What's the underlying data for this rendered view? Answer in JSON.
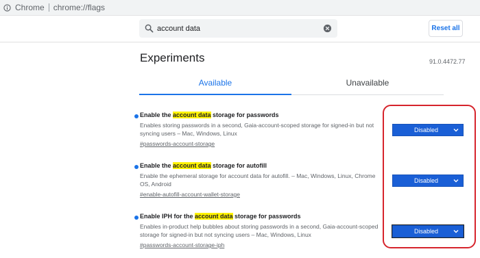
{
  "address_bar": {
    "site": "Chrome",
    "url": "chrome://flags"
  },
  "toolbar": {
    "search_value": "account data",
    "reset_label": "Reset all"
  },
  "header": {
    "title": "Experiments",
    "version": "91.0.4472.77"
  },
  "tabs": [
    {
      "label": "Available",
      "active": true
    },
    {
      "label": "Unavailable",
      "active": false
    }
  ],
  "experiments": [
    {
      "name_prefix": "Enable the ",
      "name_highlight": "account data",
      "name_suffix": " storage for passwords",
      "desc_line1": "Enables storing passwords in a second, Gaia-account-scoped storage for signed-in but not",
      "desc_line2": "syncing users – Mac, Windows, Linux",
      "link": "#passwords-account-storage",
      "select_value": "Disabled"
    },
    {
      "name_prefix": "Enable the ",
      "name_highlight": "account data",
      "name_suffix": " storage for autofill",
      "desc_line1": "Enable the ephemeral storage for account data for autofill. – Mac, Windows, Linux, Chrome",
      "desc_line2": "OS, Android",
      "link": "#enable-autofill-account-wallet-storage",
      "select_value": "Disabled"
    },
    {
      "name_prefix": "Enable IPH for the ",
      "name_highlight": "account data",
      "name_suffix": " storage for passwords",
      "desc_line1": "Enables in-product help bubbles about storing passwords in a second, Gaia-account-scoped",
      "desc_line2": "storage for signed-in but not syncing users – Mac, Windows, Linux",
      "link": "#passwords-account-storage-iph",
      "select_value": "Disabled"
    }
  ],
  "colors": {
    "accent": "#1a73e8",
    "highlight": "#fff200",
    "annotation": "#d6232b",
    "select_bg": "#1a5fd6"
  }
}
